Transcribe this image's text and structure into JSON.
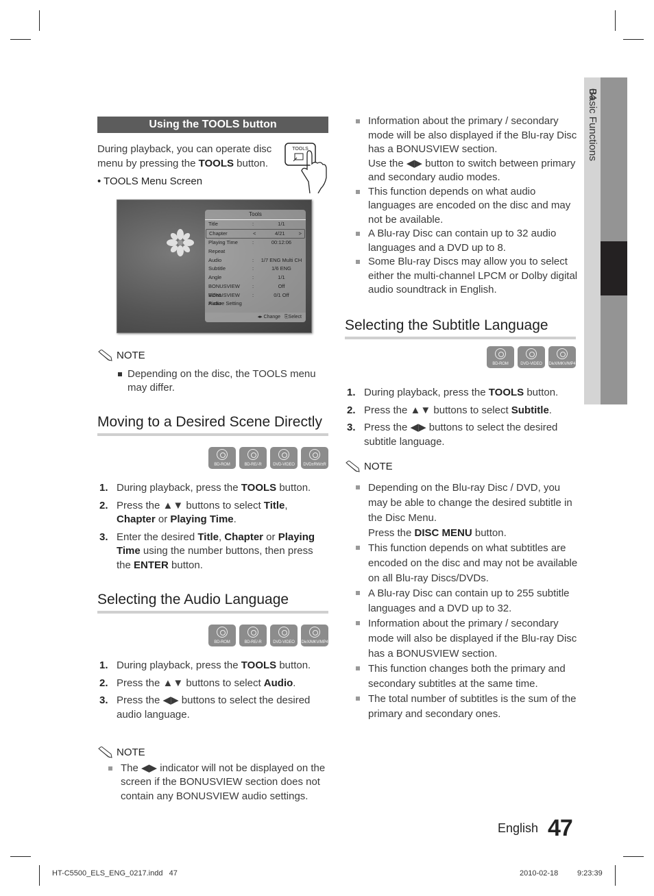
{
  "side_tab": {
    "chapter": "04",
    "label": "Basic Functions"
  },
  "left": {
    "tools_section": {
      "title": "Using the TOOLS button",
      "intro_pre": "During playback, you can operate disc menu by pressing the ",
      "intro_bold": "TOOLS",
      "intro_post": " button.",
      "button_icon_label": "TOOLS",
      "bullet": "TOOLS Menu Screen",
      "screen": {
        "title": "Tools",
        "rows": [
          {
            "key": "Title",
            "colon": ":",
            "value": "1/1",
            "selected": false
          },
          {
            "key": "Chapter",
            "colon": "<",
            "value": "4/21",
            "selected": true,
            "arrow": ">"
          },
          {
            "key": "Playing Time",
            "colon": ":",
            "value": "00:12:06",
            "selected": false
          },
          {
            "key": "Repeat",
            "colon": "",
            "value": "",
            "selected": false
          },
          {
            "key": "Audio",
            "colon": ":",
            "value": "1/7 ENG Multi CH",
            "selected": false
          },
          {
            "key": "Subtitle",
            "colon": ":",
            "value": "1/6 ENG",
            "selected": false
          },
          {
            "key": "Angle",
            "colon": ":",
            "value": "1/1",
            "selected": false
          },
          {
            "key": "BONUSVIEW Video",
            "colon": ":",
            "value": "Off",
            "selected": false
          },
          {
            "key": "BONUSVIEW Audio",
            "colon": ":",
            "value": "0/1 Off",
            "selected": false
          },
          {
            "key": "Picture Setting",
            "colon": "",
            "value": "",
            "selected": false
          }
        ],
        "footer_change": "◂▸ Change",
        "footer_select": "Select"
      },
      "note_label": "NOTE",
      "note_items": [
        "Depending on the disc, the TOOLS menu may differ."
      ]
    },
    "scene_section": {
      "title": "Moving to a Desired Scene Directly",
      "discs": [
        "BD-ROM",
        "BD-RE/-R",
        "DVD-VIDEO",
        "DVD±RW/±R"
      ],
      "steps": [
        {
          "n": "1.",
          "parts": [
            [
              "During playback, press the ",
              false
            ],
            [
              "TOOLS",
              true
            ],
            [
              " button.",
              false
            ]
          ]
        },
        {
          "n": "2.",
          "parts": [
            [
              "Press the ▲▼ buttons to select ",
              false
            ],
            [
              "Title",
              true
            ],
            [
              ", ",
              false
            ],
            [
              "Chapter",
              true
            ],
            [
              " or ",
              false
            ],
            [
              "Playing Time",
              true
            ],
            [
              ".",
              false
            ]
          ]
        },
        {
          "n": "3.",
          "parts": [
            [
              "Enter the desired ",
              false
            ],
            [
              "Title",
              true
            ],
            [
              ", ",
              false
            ],
            [
              "Chapter",
              true
            ],
            [
              " or ",
              false
            ],
            [
              "Playing Time",
              true
            ],
            [
              " using the number buttons, then press the ",
              false
            ],
            [
              "ENTER",
              true
            ],
            [
              " button.",
              false
            ]
          ]
        }
      ]
    },
    "audio_section": {
      "title": "Selecting the Audio Language",
      "discs": [
        "BD-ROM",
        "BD-RE/-R",
        "DVD-VIDEO",
        "DivX/MKV/MP4"
      ],
      "steps": [
        {
          "n": "1.",
          "parts": [
            [
              "During playback, press the ",
              false
            ],
            [
              "TOOLS",
              true
            ],
            [
              " button.",
              false
            ]
          ]
        },
        {
          "n": "2.",
          "parts": [
            [
              "Press the ▲▼ buttons to select ",
              false
            ],
            [
              "Audio",
              true
            ],
            [
              ".",
              false
            ]
          ]
        },
        {
          "n": "3.",
          "parts": [
            [
              "Press the ◀▶ buttons to select the desired audio language.",
              false
            ]
          ]
        }
      ],
      "note_label": "NOTE",
      "note_items": [
        "The ◀▶ indicator will not be displayed on the screen if the BONUSVIEW section does not contain any BONUSVIEW audio settings."
      ]
    }
  },
  "right": {
    "audio_notes": [
      "Information about the primary / secondary mode will be also displayed if the Blu-ray Disc has a BONUSVIEW section.\nUse the ◀▶ button to switch between primary and secondary audio modes.",
      "This function depends on what audio languages are encoded on the disc and may not be available.",
      "A Blu-ray Disc can contain up to 32 audio languages and a DVD up to 8.",
      "Some Blu-ray Discs may allow you to select either the multi-channel LPCM or Dolby digital audio soundtrack in English."
    ],
    "subtitle_section": {
      "title": "Selecting the Subtitle Language",
      "discs": [
        "BD-ROM",
        "DVD-VIDEO",
        "DivX/MKV/MP4"
      ],
      "steps": [
        {
          "n": "1.",
          "parts": [
            [
              "During playback, press the ",
              false
            ],
            [
              "TOOLS",
              true
            ],
            [
              " button.",
              false
            ]
          ]
        },
        {
          "n": "2.",
          "parts": [
            [
              "Press the ▲▼ buttons to select ",
              false
            ],
            [
              "Subtitle",
              true
            ],
            [
              ".",
              false
            ]
          ]
        },
        {
          "n": "3.",
          "parts": [
            [
              "Press the ◀▶ buttons to select the desired subtitle language.",
              false
            ]
          ]
        }
      ],
      "note_label": "NOTE",
      "note_items": [
        {
          "parts": [
            [
              "Depending on the Blu-ray Disc / DVD, you may be able to change the desired subtitle in the Disc Menu.\nPress the ",
              false
            ],
            [
              "DISC MENU",
              true
            ],
            [
              " button.",
              false
            ]
          ]
        },
        {
          "parts": [
            [
              "This function depends on what subtitles are encoded on the disc and may not be available on all Blu-ray Discs/DVDs.",
              false
            ]
          ]
        },
        {
          "parts": [
            [
              "A Blu-ray Disc can contain up to 255 subtitle languages and a DVD up to 32.",
              false
            ]
          ]
        },
        {
          "parts": [
            [
              "Information about the primary / secondary mode will also be displayed if the Blu-ray Disc has a BONUSVIEW section.",
              false
            ]
          ]
        },
        {
          "parts": [
            [
              "This function changes both the primary and secondary subtitles at the same time.",
              false
            ]
          ]
        },
        {
          "parts": [
            [
              "The total number of subtitles is the sum of the primary and secondary ones.",
              false
            ]
          ]
        }
      ]
    }
  },
  "footer": {
    "language": "English",
    "page_number": "47",
    "file_name": "HT-C5500_ELS_ENG_0217.indd   47",
    "date": "2010-02-18",
    "time": "9:23:39"
  }
}
